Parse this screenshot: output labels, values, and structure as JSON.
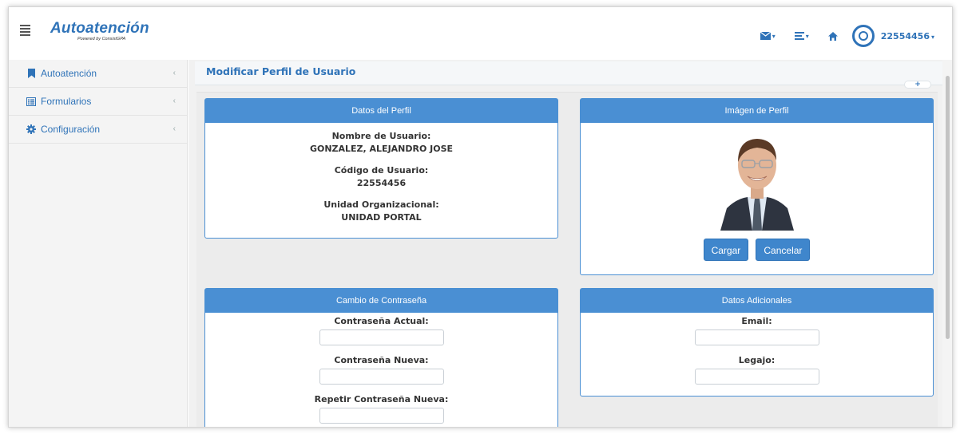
{
  "app": {
    "brand_title": "Autoatención",
    "brand_subtitle": "Powered by ConsistGPA",
    "user_code": "22554456"
  },
  "icons": {
    "mail": "mail-icon",
    "menu_list": "list-icon",
    "home": "home-icon",
    "avatar": "user-avatar-icon"
  },
  "sidebar": {
    "items": [
      {
        "label": "Autoatención",
        "icon": "bookmark-icon"
      },
      {
        "label": "Formularios",
        "icon": "list-box-icon"
      },
      {
        "label": "Configuración",
        "icon": "gear-icon"
      }
    ]
  },
  "page": {
    "title": "Modificar Perfil de Usuario",
    "expand_label": "+"
  },
  "profile": {
    "title": "Datos del Perfil",
    "username_label": "Nombre de Usuario:",
    "username_value": "GONZALEZ, ALEJANDRO JOSE",
    "code_label": "Código de Usuario:",
    "code_value": "22554456",
    "unit_label": "Unidad Organizacional:",
    "unit_value": "UNIDAD PORTAL"
  },
  "image_panel": {
    "title": "Imágen de Perfil",
    "upload_label": "Cargar",
    "cancel_label": "Cancelar"
  },
  "password_panel": {
    "title": "Cambio de Contraseña",
    "current_label": "Contraseña Actual:",
    "new_label": "Contraseña Nueva:",
    "repeat_label": "Repetir Contraseña Nueva:"
  },
  "additional_panel": {
    "title": "Datos Adicionales",
    "email_label": "Email:",
    "legajo_label": "Legajo:"
  },
  "colors": {
    "brand": "#2f73b8",
    "panel_header": "#4a8fd3",
    "button": "#3f86cc"
  }
}
